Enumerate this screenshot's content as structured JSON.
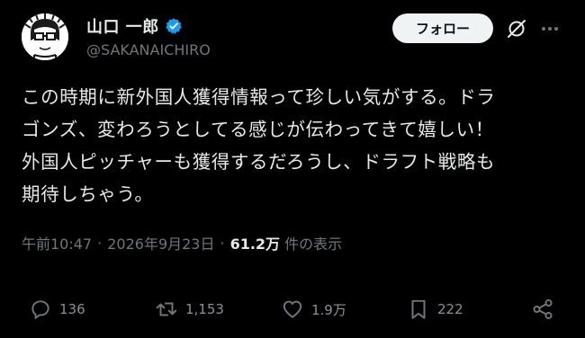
{
  "user": {
    "display_name": "山口 一郎",
    "handle": "@SAKANAICHIRO"
  },
  "follow_label": "フォロー",
  "tweet": {
    "text": "この時期に新外国人獲得情報って珍しい気がする。ドラ\nゴンズ、変わろうとしてる感じが伝わってきて嬉しい！\n外国人ピッチャーも獲得するだろうし、ドラフト戦略も\n期待しちゃう。"
  },
  "meta": {
    "time": "午前10:47",
    "separator": "·",
    "date": "2026年9月23日",
    "views_count": "61.2万",
    "views_label": "件の表示"
  },
  "actions": {
    "replies": "136",
    "reposts": "1,153",
    "likes": "1.9万",
    "bookmarks": "222"
  },
  "colors": {
    "background": "#000000",
    "text": "#e7e9ea",
    "secondary": "#71767b",
    "verified": "#1d9bf0",
    "button_bg": "#eff3f4"
  },
  "icons": [
    "verified-badge-icon",
    "grok-icon",
    "more-icon",
    "reply-icon",
    "repost-icon",
    "like-icon",
    "bookmark-icon",
    "share-icon"
  ]
}
